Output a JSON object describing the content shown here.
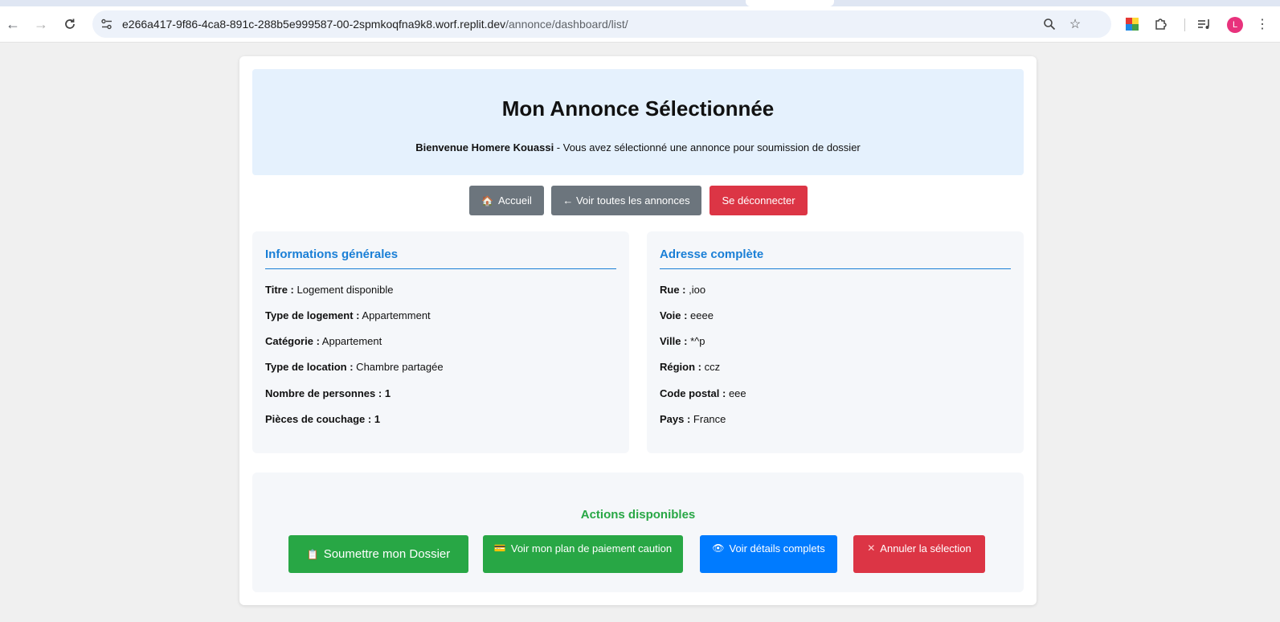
{
  "browser": {
    "url_host": "e266a417-9f86-4ca8-891c-288b5e999587-00-2spmkoqfna9k8.worf.replit.dev",
    "url_path": "/annonce/dashboard/list/",
    "profile_initial": "L"
  },
  "header": {
    "title": "Mon Annonce Sélectionnée",
    "welcome_name": "Bienvenue Homere Kouassi",
    "welcome_rest": " - Vous avez sélectionné une annonce pour soumission de dossier"
  },
  "nav_buttons": {
    "home": "Accueil",
    "all_listings": "← Voir toutes les annonces",
    "logout": "Se déconnecter"
  },
  "general_info": {
    "title": "Informations générales",
    "rows": [
      {
        "label": "Titre :",
        "value": " Logement disponible"
      },
      {
        "label": "Type de logement :",
        "value": " Appartemment"
      },
      {
        "label": "Catégorie :",
        "value": " Appartement"
      },
      {
        "label": "Type de location :",
        "value": " Chambre partagée"
      },
      {
        "label": "Nombre de personnes :",
        "value": " 1"
      },
      {
        "label": "Pièces de couchage :",
        "value": " 1"
      }
    ]
  },
  "address": {
    "title": "Adresse complète",
    "rows": [
      {
        "label": "Rue :",
        "value": " ,ioo"
      },
      {
        "label": "Voie :",
        "value": " eeee"
      },
      {
        "label": "Ville :",
        "value": " *^p"
      },
      {
        "label": "Région :",
        "value": " ccz"
      },
      {
        "label": "Code postal :",
        "value": " eee"
      },
      {
        "label": "Pays :",
        "value": " France"
      }
    ]
  },
  "actions": {
    "title": "Actions disponibles",
    "submit": "Soumettre mon Dossier",
    "payment_plan": "Voir mon plan de paiement caution",
    "details": "Voir détails complets",
    "cancel": "Annuler la sélection"
  },
  "colors": {
    "accent_blue": "#1a7fd6",
    "green": "#28a745",
    "red": "#dc3545",
    "grey": "#6c757d",
    "blue": "#007bff"
  }
}
